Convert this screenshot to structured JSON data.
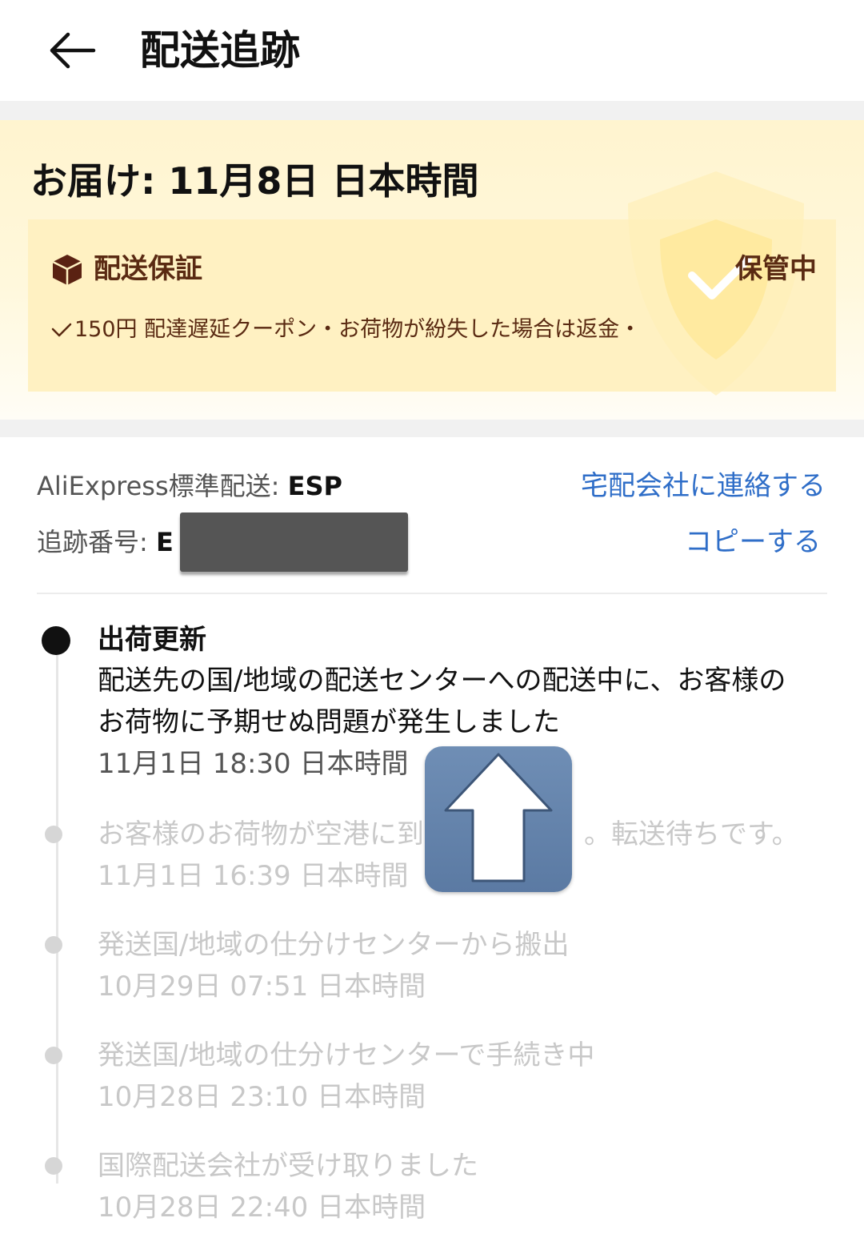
{
  "header": {
    "title": "配送追跡"
  },
  "delivery": {
    "estimate": "お届け: 11月8日 日本時間",
    "guarantee_label": "配送保証",
    "guarantee_status": "保管中",
    "guarantee_detail": "150円 配達遅延クーポン・お荷物が紛失した場合は返金・"
  },
  "shipping": {
    "carrier_label": "AliExpress標準配送: ",
    "carrier_value": "ESP",
    "contact_link": "宅配会社に連絡する",
    "tracking_label": "追跡番号: ",
    "tracking_value": "E",
    "copy_link": "コピーする"
  },
  "timeline": [
    {
      "title": "出荷更新",
      "desc_line1": "配送先の国/地域の配送センターへの配送中に、お客様の",
      "desc_line2": "お荷物に予期せぬ問題が発生しました",
      "time": "11月1日 18:30 日本時間"
    },
    {
      "desc": "お客様のお荷物が空港に到",
      "desc_tail": "。転送待ちです。",
      "time": "11月1日 16:39 日本時間"
    },
    {
      "desc": "発送国/地域の仕分けセンターから搬出",
      "time": "10月29日 07:51 日本時間"
    },
    {
      "desc": "発送国/地域の仕分けセンターで手続き中",
      "time": "10月28日 23:10 日本時間"
    },
    {
      "desc": "国際配送会社が受け取りました",
      "time": "10月28日 22:40 日本時間"
    }
  ],
  "colors": {
    "link": "#2f6ec8",
    "guarantee_text": "#5a2a12",
    "card_bg": "#fff1c2"
  }
}
